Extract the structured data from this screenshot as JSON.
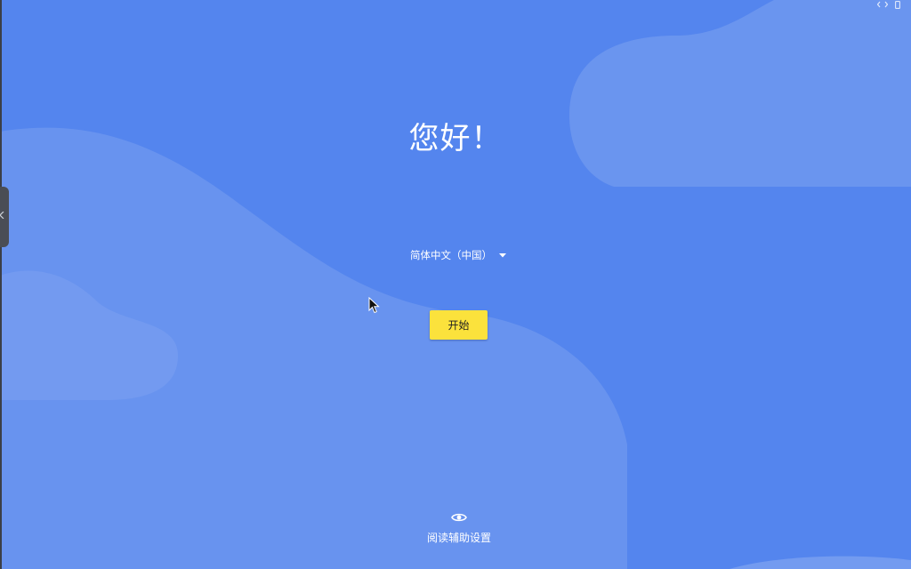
{
  "colors": {
    "background": "#5485ee",
    "wave_light": "#6f98ef",
    "start_button": "#fbe23c"
  },
  "icons": {
    "top_right": [
      "resize-arrows-icon",
      "phone-icon"
    ],
    "side": "chevron-left-icon",
    "language": "dropdown-caret-icon",
    "accessibility": "eye-icon",
    "pointer": "mouse-cursor-icon"
  },
  "greeting": "您好！",
  "language": {
    "selected": "简体中文（中国）"
  },
  "start_button": {
    "label": "开始"
  },
  "accessibility": {
    "label": "阅读辅助设置"
  }
}
